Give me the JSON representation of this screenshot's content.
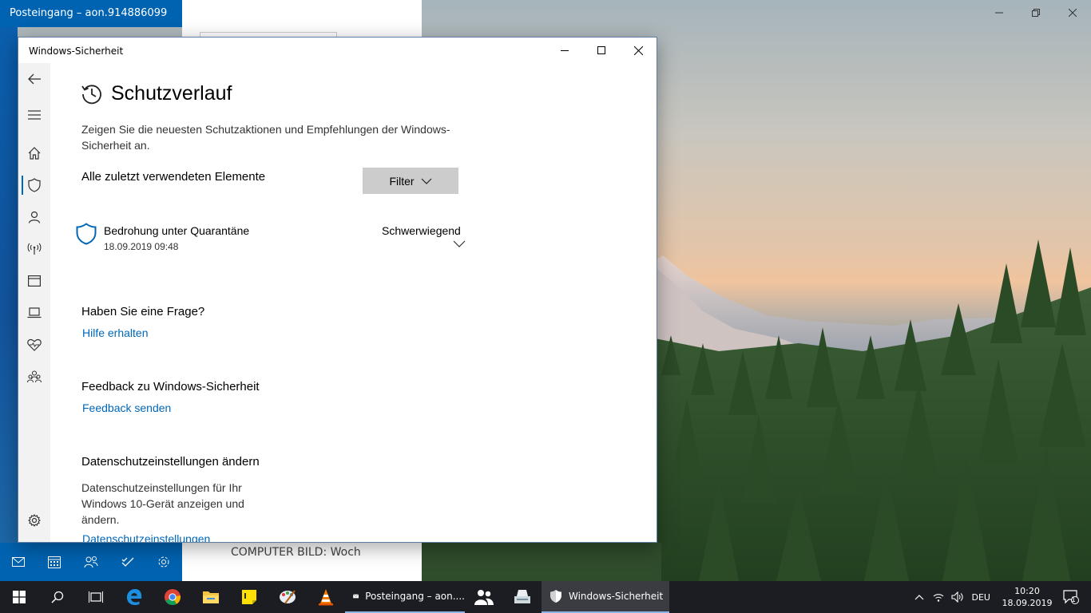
{
  "mail": {
    "title": "Posteingang – aon.914886099",
    "preview_text": "COMPUTER BILD: Woch"
  },
  "window": {
    "title": "Windows-Sicherheit"
  },
  "page": {
    "title": "Schutzverlauf",
    "description": "Zeigen Sie die neuesten Schutzaktionen und Empfehlungen der Windows-Sicherheit an.",
    "recent_label": "Alle zuletzt verwendeten Elemente",
    "filter_label": "Filter"
  },
  "threat": {
    "name": "Bedrohung unter Quarantäne",
    "date": "18.09.2019 09:48",
    "severity": "Schwerwiegend"
  },
  "sections": {
    "question_heading": "Haben Sie eine Frage?",
    "help_link": "Hilfe erhalten",
    "feedback_heading": "Feedback zu Windows-Sicherheit",
    "feedback_link": "Feedback senden",
    "privacy_heading": "Datenschutzeinstellungen ändern",
    "privacy_desc": "Datenschutzeinstellungen für Ihr Windows 10-Gerät anzeigen und ändern.",
    "privacy_link": "Datenschutzeinstellungen"
  },
  "taskbar": {
    "mail_app": "Posteingang – aon....",
    "security_app": "Windows-Sicherheit",
    "language": "DEU",
    "time": "10:20",
    "date": "18.09.2019",
    "notification_count": "1"
  },
  "colors": {
    "accent": "#0067b8",
    "mail_blue": "#0063b1",
    "taskbar": "#1b1d22"
  }
}
